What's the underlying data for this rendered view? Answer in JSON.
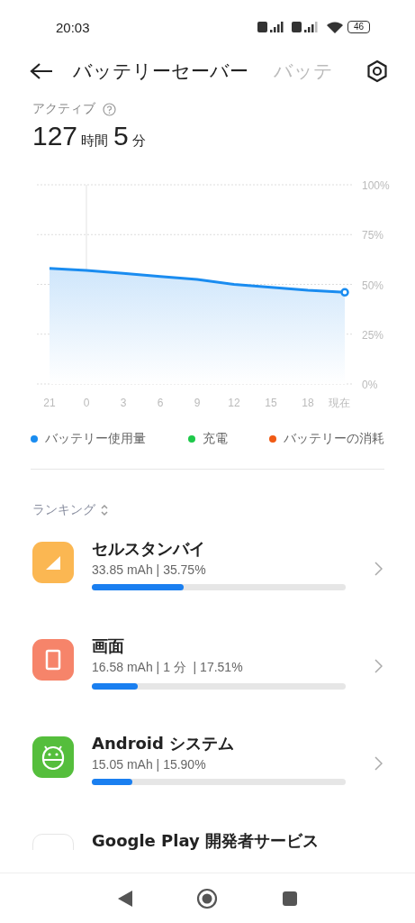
{
  "status_bar": {
    "time": "20:03",
    "battery": "46"
  },
  "header": {
    "tabs": [
      {
        "label": "バッテリーセーバー",
        "selected": true
      },
      {
        "label": "バッテ",
        "selected": false
      }
    ]
  },
  "active": {
    "label": "アクティブ",
    "time": [
      {
        "value": "127",
        "unit": "時間"
      },
      {
        "value": "5",
        "unit": "分"
      }
    ]
  },
  "chart": {
    "chart_data": {
      "type": "area",
      "grid": true,
      "ylim": [
        0,
        100
      ],
      "ref_lines": [
        {
          "axis": "x",
          "value": "0"
        }
      ],
      "categories": [
        "21",
        "0",
        "3",
        "6",
        "9",
        "12",
        "15",
        "18",
        "現在"
      ],
      "yticks": [
        {
          "value": 0,
          "label": "0%"
        },
        {
          "value": 25,
          "label": "25%"
        },
        {
          "value": 50,
          "label": "50%"
        },
        {
          "value": 75,
          "label": "75%"
        },
        {
          "value": 100,
          "label": "100%"
        }
      ],
      "series": [
        {
          "name": "バッテリー使用量",
          "color": "#1a8cf0",
          "values": [
            58,
            57,
            55.5,
            54,
            52.5,
            50,
            48.5,
            47,
            46
          ]
        },
        {
          "name": "充電",
          "color": "#1ec94a",
          "values": [
            null,
            null,
            null,
            null,
            null,
            null,
            null,
            null,
            null
          ]
        },
        {
          "name": "バッテリーの消耗",
          "color": "#f05a14",
          "values": [
            null,
            null,
            null,
            null,
            null,
            null,
            null,
            null,
            null
          ]
        }
      ]
    }
  },
  "ranking": {
    "label": "ランキング",
    "items": [
      {
        "kind": "signal",
        "title": "セルスタンバイ",
        "detail": "33.85 mAh | 35.75%",
        "level": 0.36
      },
      {
        "kind": "screen",
        "title": "画面",
        "detail": "16.58 mAh | 1 分  | 17.51%",
        "level": 0.18
      },
      {
        "kind": "android",
        "title": "Android システム",
        "detail": "15.05 mAh | 15.90%",
        "level": 0.16
      },
      {
        "kind": "play",
        "title": "Google Play 開発者サービス"
      }
    ]
  }
}
